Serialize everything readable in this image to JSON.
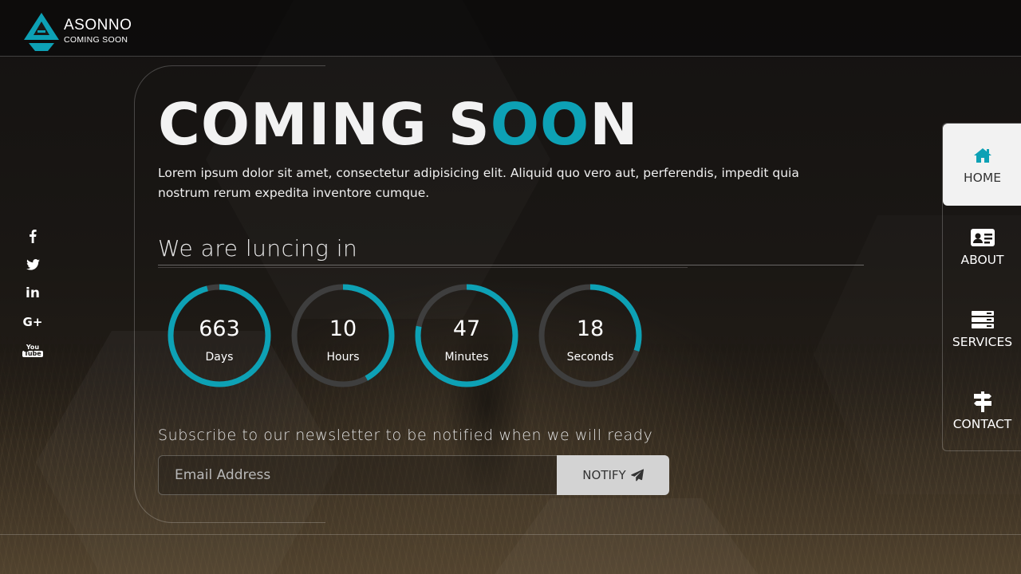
{
  "brand": {
    "name": "ASONNO",
    "tagline": "COMING SOON",
    "logo_icon": "a-triangle-logo",
    "accent_color": "#0da1b5"
  },
  "hero": {
    "title_part1": "COMING S",
    "title_accent": "OO",
    "title_part2": "N",
    "intro": "Lorem ipsum dolor sit amet, consectetur adipisicing elit. Aliquid quo vero aut, perferendis, impedit quia nostrum rerum expedita inventore cumque."
  },
  "launch": {
    "heading": "We are luncing in"
  },
  "countdown": [
    {
      "value": "663",
      "label": "Days",
      "progress": 0.96
    },
    {
      "value": "10",
      "label": "Hours",
      "progress": 0.42
    },
    {
      "value": "47",
      "label": "Minutes",
      "progress": 0.78
    },
    {
      "value": "18",
      "label": "Seconds",
      "progress": 0.3
    }
  ],
  "countdown_colors": {
    "ring_track": "#3e3e3e",
    "ring_fill": "#0da1b5"
  },
  "newsletter": {
    "heading": "Subscribe to our newsletter to be notified when we will ready",
    "email_placeholder": "Email Address",
    "button_label": "NOTIFY",
    "button_icon": "paper-plane-icon"
  },
  "social": [
    {
      "name": "facebook",
      "icon": "facebook-icon"
    },
    {
      "name": "twitter",
      "icon": "twitter-icon"
    },
    {
      "name": "linkedin",
      "icon": "linkedin-icon",
      "glyph": "in"
    },
    {
      "name": "google-plus",
      "icon": "google-plus-icon",
      "glyph": "G+"
    },
    {
      "name": "youtube",
      "icon": "youtube-icon",
      "glyph": "You Tube"
    }
  ],
  "nav": {
    "items": [
      {
        "label": "HOME",
        "icon": "home-icon",
        "active": true
      },
      {
        "label": "ABOUT",
        "icon": "id-card-icon",
        "active": false
      },
      {
        "label": "SERVICES",
        "icon": "server-icon",
        "active": false
      },
      {
        "label": "CONTACT",
        "icon": "signpost-icon",
        "active": false
      }
    ]
  }
}
